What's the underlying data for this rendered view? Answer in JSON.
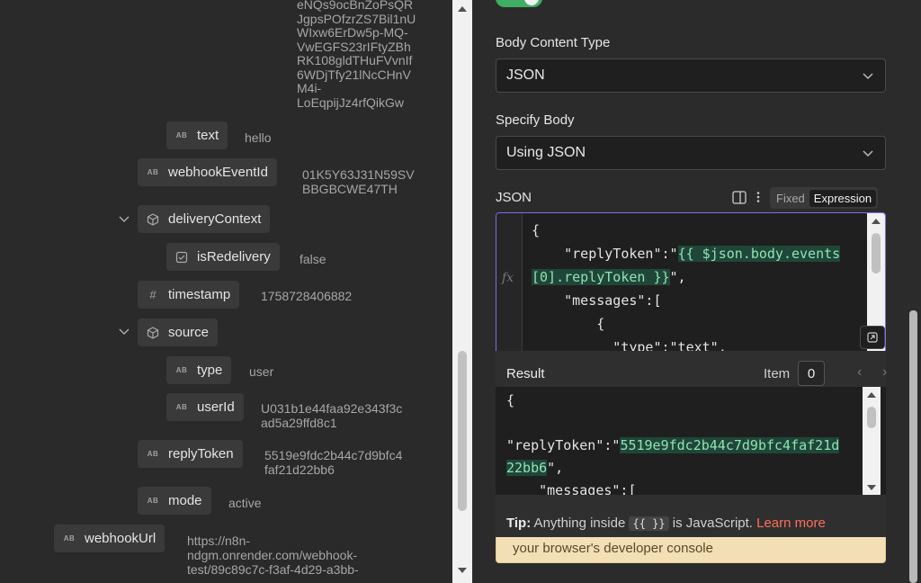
{
  "schema": {
    "token_fragment": "eNQs9ocBnZoPsQR\nJgpsPOfzrZS7Bil1nU\nWIxw6ErDw5p-MQ-\nVwEGFS23rIFtyZBh\nRK108gldTHuFVvnIf\n6WDjTfy21lNcCHnV\nM4i-\nLoEqpijJz4rfQikGw",
    "fields": [
      {
        "name": "text",
        "type": "AB",
        "value": "hello"
      },
      {
        "name": "webhookEventId",
        "type": "AB",
        "value": "01K5Y63J31N59SV\nBBGBCWE47TH"
      },
      {
        "name": "deliveryContext",
        "type": "object"
      },
      {
        "name": "isRedelivery",
        "type": "boolean",
        "value": "false"
      },
      {
        "name": "timestamp",
        "type": "#",
        "value": "1758728406882"
      },
      {
        "name": "source",
        "type": "object"
      },
      {
        "name": "type",
        "type": "AB",
        "value": "user"
      },
      {
        "name": "userId",
        "type": "AB",
        "value": "U031b1e44faa92e343f3c\nad5a29ffd8c1"
      },
      {
        "name": "replyToken",
        "type": "AB",
        "value": "5519e9fdc2b44c7d9bfc4\nfaf21d22bb6"
      },
      {
        "name": "mode",
        "type": "AB",
        "value": "active"
      },
      {
        "name": "webhookUrl",
        "type": "AB",
        "value": "https://n8n-\nndgm.onrender.com/webhook-\ntest/89c89c7c-f3af-4d29-a3bb-"
      }
    ]
  },
  "params": {
    "body_content_type_label": "Body Content Type",
    "body_content_type_value": "JSON",
    "specify_body_label": "Specify Body",
    "specify_body_value": "Using JSON",
    "json_label": "JSON",
    "mode_fixed": "Fixed",
    "mode_expression": "Expression"
  },
  "editor": {
    "line1": "{",
    "line2_key": "    \"replyToken\":\"",
    "line2_expr": "{{ $json.body.events",
    "line3_expr": "[0].replyToken }}",
    "line3_tail": "\",",
    "line4": "    \"messages\":[",
    "line5": "        {",
    "line6": "          \"type\":\"text\","
  },
  "result": {
    "title": "Result",
    "item_label": "Item",
    "item_index": "0",
    "line1": "{",
    "line2_key": "\"replyToken\":\"",
    "line2_val": "5519e9fdc2b44c7d9bfc4faf21d",
    "line3_val": "22bb6",
    "line3_tail": "\",",
    "line4": "    \"messages\":[",
    "tip_label": "Tip:",
    "tip_text": " Anything inside ",
    "tip_code": "{{ }}",
    "tip_text2": " is JavaScript. ",
    "tip_link": "Learn more"
  },
  "warning_text": "your browser's developer console"
}
